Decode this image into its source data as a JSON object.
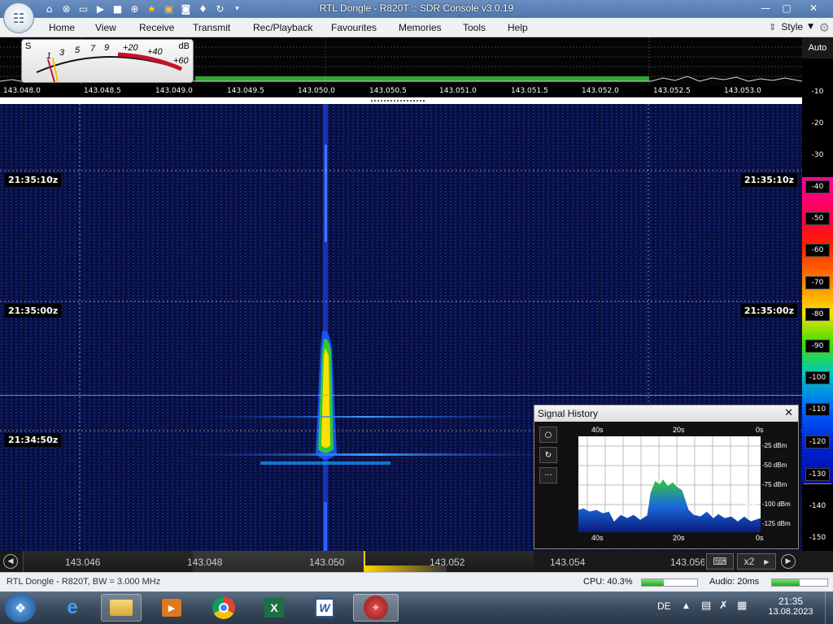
{
  "window": {
    "title": "RTL Dongle - R820T :: SDR Console v3.0.19",
    "minimize": "—",
    "maximize": "▢",
    "close": "✕"
  },
  "menu": [
    "Home",
    "View",
    "Receive",
    "Transmit",
    "Rec/Playback",
    "Favourites",
    "Memories",
    "Tools",
    "Help"
  ],
  "style_label": "Style",
  "smeter": {
    "s_label": "S",
    "db_label": "dB",
    "scale": [
      "1",
      "3",
      "5",
      "7",
      "9",
      "+20",
      "+40",
      "+60"
    ]
  },
  "freq_scale": [
    "143.048.0",
    "143.048.5",
    "143.049.0",
    "143.049.5",
    "143.050.0",
    "143.050.5",
    "143.051.0",
    "143.051.5",
    "143.052.0",
    "143.052.5",
    "143.053.0"
  ],
  "db_scale": {
    "auto": "Auto",
    "labels": [
      "-10",
      "-20",
      "-30",
      "-40",
      "-50",
      "-60",
      "-70",
      "-80",
      "-90",
      "-100",
      "-110",
      "-120",
      "-130",
      "-140",
      "-150"
    ]
  },
  "waterfall_times": [
    "21:35:10z",
    "21:35:00z",
    "21:34:50z"
  ],
  "tuner": {
    "freqs": [
      "143.046",
      "143.048",
      "143.050",
      "143.052",
      "143.054",
      "143.056"
    ],
    "zoom": "x2"
  },
  "signal_history": {
    "title": "Signal History",
    "x_labels": [
      "40s",
      "20s",
      "0s"
    ],
    "y_labels": [
      "-25 dBm",
      "-50 dBm",
      "-75 dBm",
      "-100 dBm",
      "-125 dBm"
    ],
    "s_reading": "S2",
    "buttons": [
      "○",
      "↻",
      "···"
    ]
  },
  "status": {
    "device": "RTL Dongle - R820T, BW = 3.000 MHz",
    "cpu": "CPU: 40.3%",
    "cpu_level": 0.403,
    "audio": "Audio: 20ms",
    "audio_level": 0.5
  },
  "taskbar": {
    "lang": "DE",
    "time": "21:35",
    "date": "13.08.2023"
  },
  "colors": {
    "waterfall_bg": "#050a35",
    "signal_core": "#ffe000",
    "spectrum_green": "#2ea82e",
    "title_blue": "#5b82b8"
  }
}
